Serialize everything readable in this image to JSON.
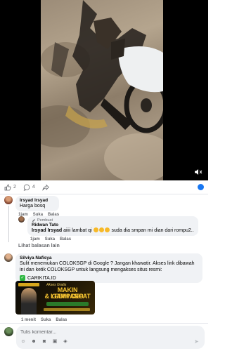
{
  "reactions": {
    "like_count": "2",
    "comment_count": "4"
  },
  "comments": [
    {
      "author": "Irsyad Irsyad",
      "text": "Harga bosq",
      "actions": {
        "time": "1jam",
        "like": "Suka",
        "reply": "Balas"
      },
      "reply": {
        "badge": "Pembuat",
        "author": "Ridwan Tato",
        "mention": "Irsyad Irsyad",
        "text_a": "aiiii lambat qi",
        "text_b": "suda dia smpan mi dian dari rompu2..",
        "actions": {
          "time": "1jam",
          "like": "Suka",
          "reply": "Balas"
        }
      }
    },
    {
      "author": "Silviya Nafisya",
      "text": "Sulit menemukan COLOKSGP di Google ? Jangan khawatir. Akses link dibawah ini dan ketik COLOKSGP untuk langsung mengakses situs resmi:",
      "link": "CARIKITA.ID",
      "ad": {
        "top": "Akses Gratis",
        "line1": "MAKIN GAMPANG",
        "line2": "& LEBIH CEPAT"
      },
      "actions": {
        "time": "1 menit",
        "like": "Suka",
        "reply": "Balas"
      }
    }
  ],
  "more_replies": "Lihat balasan lain",
  "composer": {
    "placeholder": "Tulis komentar..."
  },
  "icons": {
    "like": "thumbs-up-icon",
    "comment": "comment-icon",
    "share": "share-icon",
    "mute": "volume-muted-icon",
    "verified": "globe-icon"
  },
  "colors": {
    "accent": "#1877f2",
    "bubble": "#f0f2f5",
    "muted_text": "#65676b"
  }
}
